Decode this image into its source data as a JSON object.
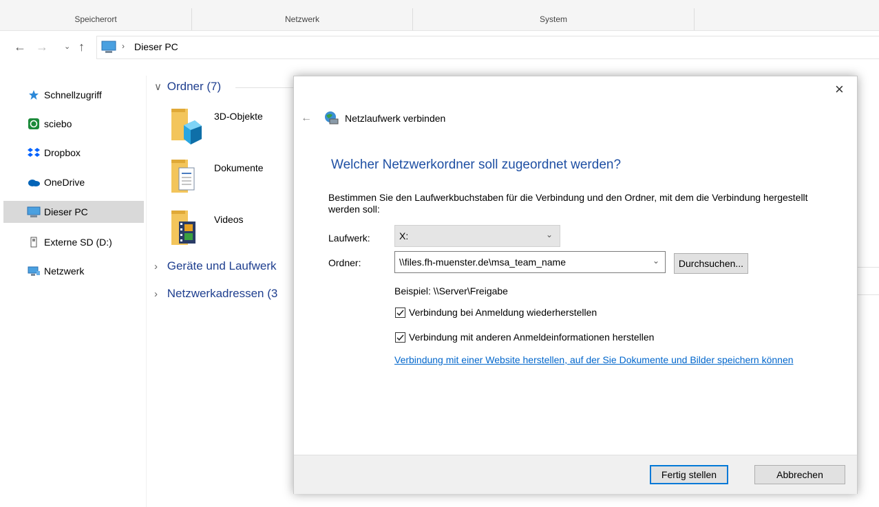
{
  "ribbon": {
    "groups": [
      "Speicherort",
      "Netzwerk",
      "System"
    ]
  },
  "nav": {
    "path_item": "Dieser PC"
  },
  "sidebar": {
    "items": [
      {
        "label": "Schnellzugriff",
        "icon": "star-icon"
      },
      {
        "label": "sciebo",
        "icon": "sciebo-icon"
      },
      {
        "label": "Dropbox",
        "icon": "dropbox-icon"
      },
      {
        "label": "OneDrive",
        "icon": "cloud-icon"
      },
      {
        "label": "Dieser PC",
        "icon": "computer-icon"
      },
      {
        "label": "Externe SD (D:)",
        "icon": "sd-card-icon"
      },
      {
        "label": "Netzwerk",
        "icon": "network-icon"
      }
    ]
  },
  "content": {
    "sections": {
      "ordner": "Ordner (7)",
      "geraete": "Geräte und Laufwerk",
      "netzwerk": "Netzwerkadressen (3"
    },
    "folders": [
      "3D-Objekte",
      "Dokumente",
      "Videos"
    ]
  },
  "dialog": {
    "title": "Netzlaufwerk verbinden",
    "heading": "Welcher Netzwerkordner soll zugeordnet werden?",
    "description": "Bestimmen Sie den Laufwerkbuchstaben für die Verbindung und den Ordner, mit dem die Verbindung hergestellt werden soll:",
    "laufwerk_label": "Laufwerk:",
    "laufwerk_value": "X:",
    "ordner_label": "Ordner:",
    "ordner_value": "\\\\files.fh-muenster.de\\msa_team_name",
    "browse_button": "Durchsuchen...",
    "example": "Beispiel: \\\\Server\\Freigabe",
    "checkbox1": "Verbindung bei Anmeldung wiederherstellen",
    "checkbox2": "Verbindung mit anderen Anmeldeinformationen herstellen",
    "link": "Verbindung mit einer Website herstellen, auf der Sie Dokumente und Bilder speichern können",
    "finish_button": "Fertig stellen",
    "cancel_button": "Abbrechen"
  },
  "colors": {
    "accent": "#0078d7",
    "heading": "#1e4fa3",
    "link": "#0066cc",
    "section": "#1f3f8f"
  }
}
